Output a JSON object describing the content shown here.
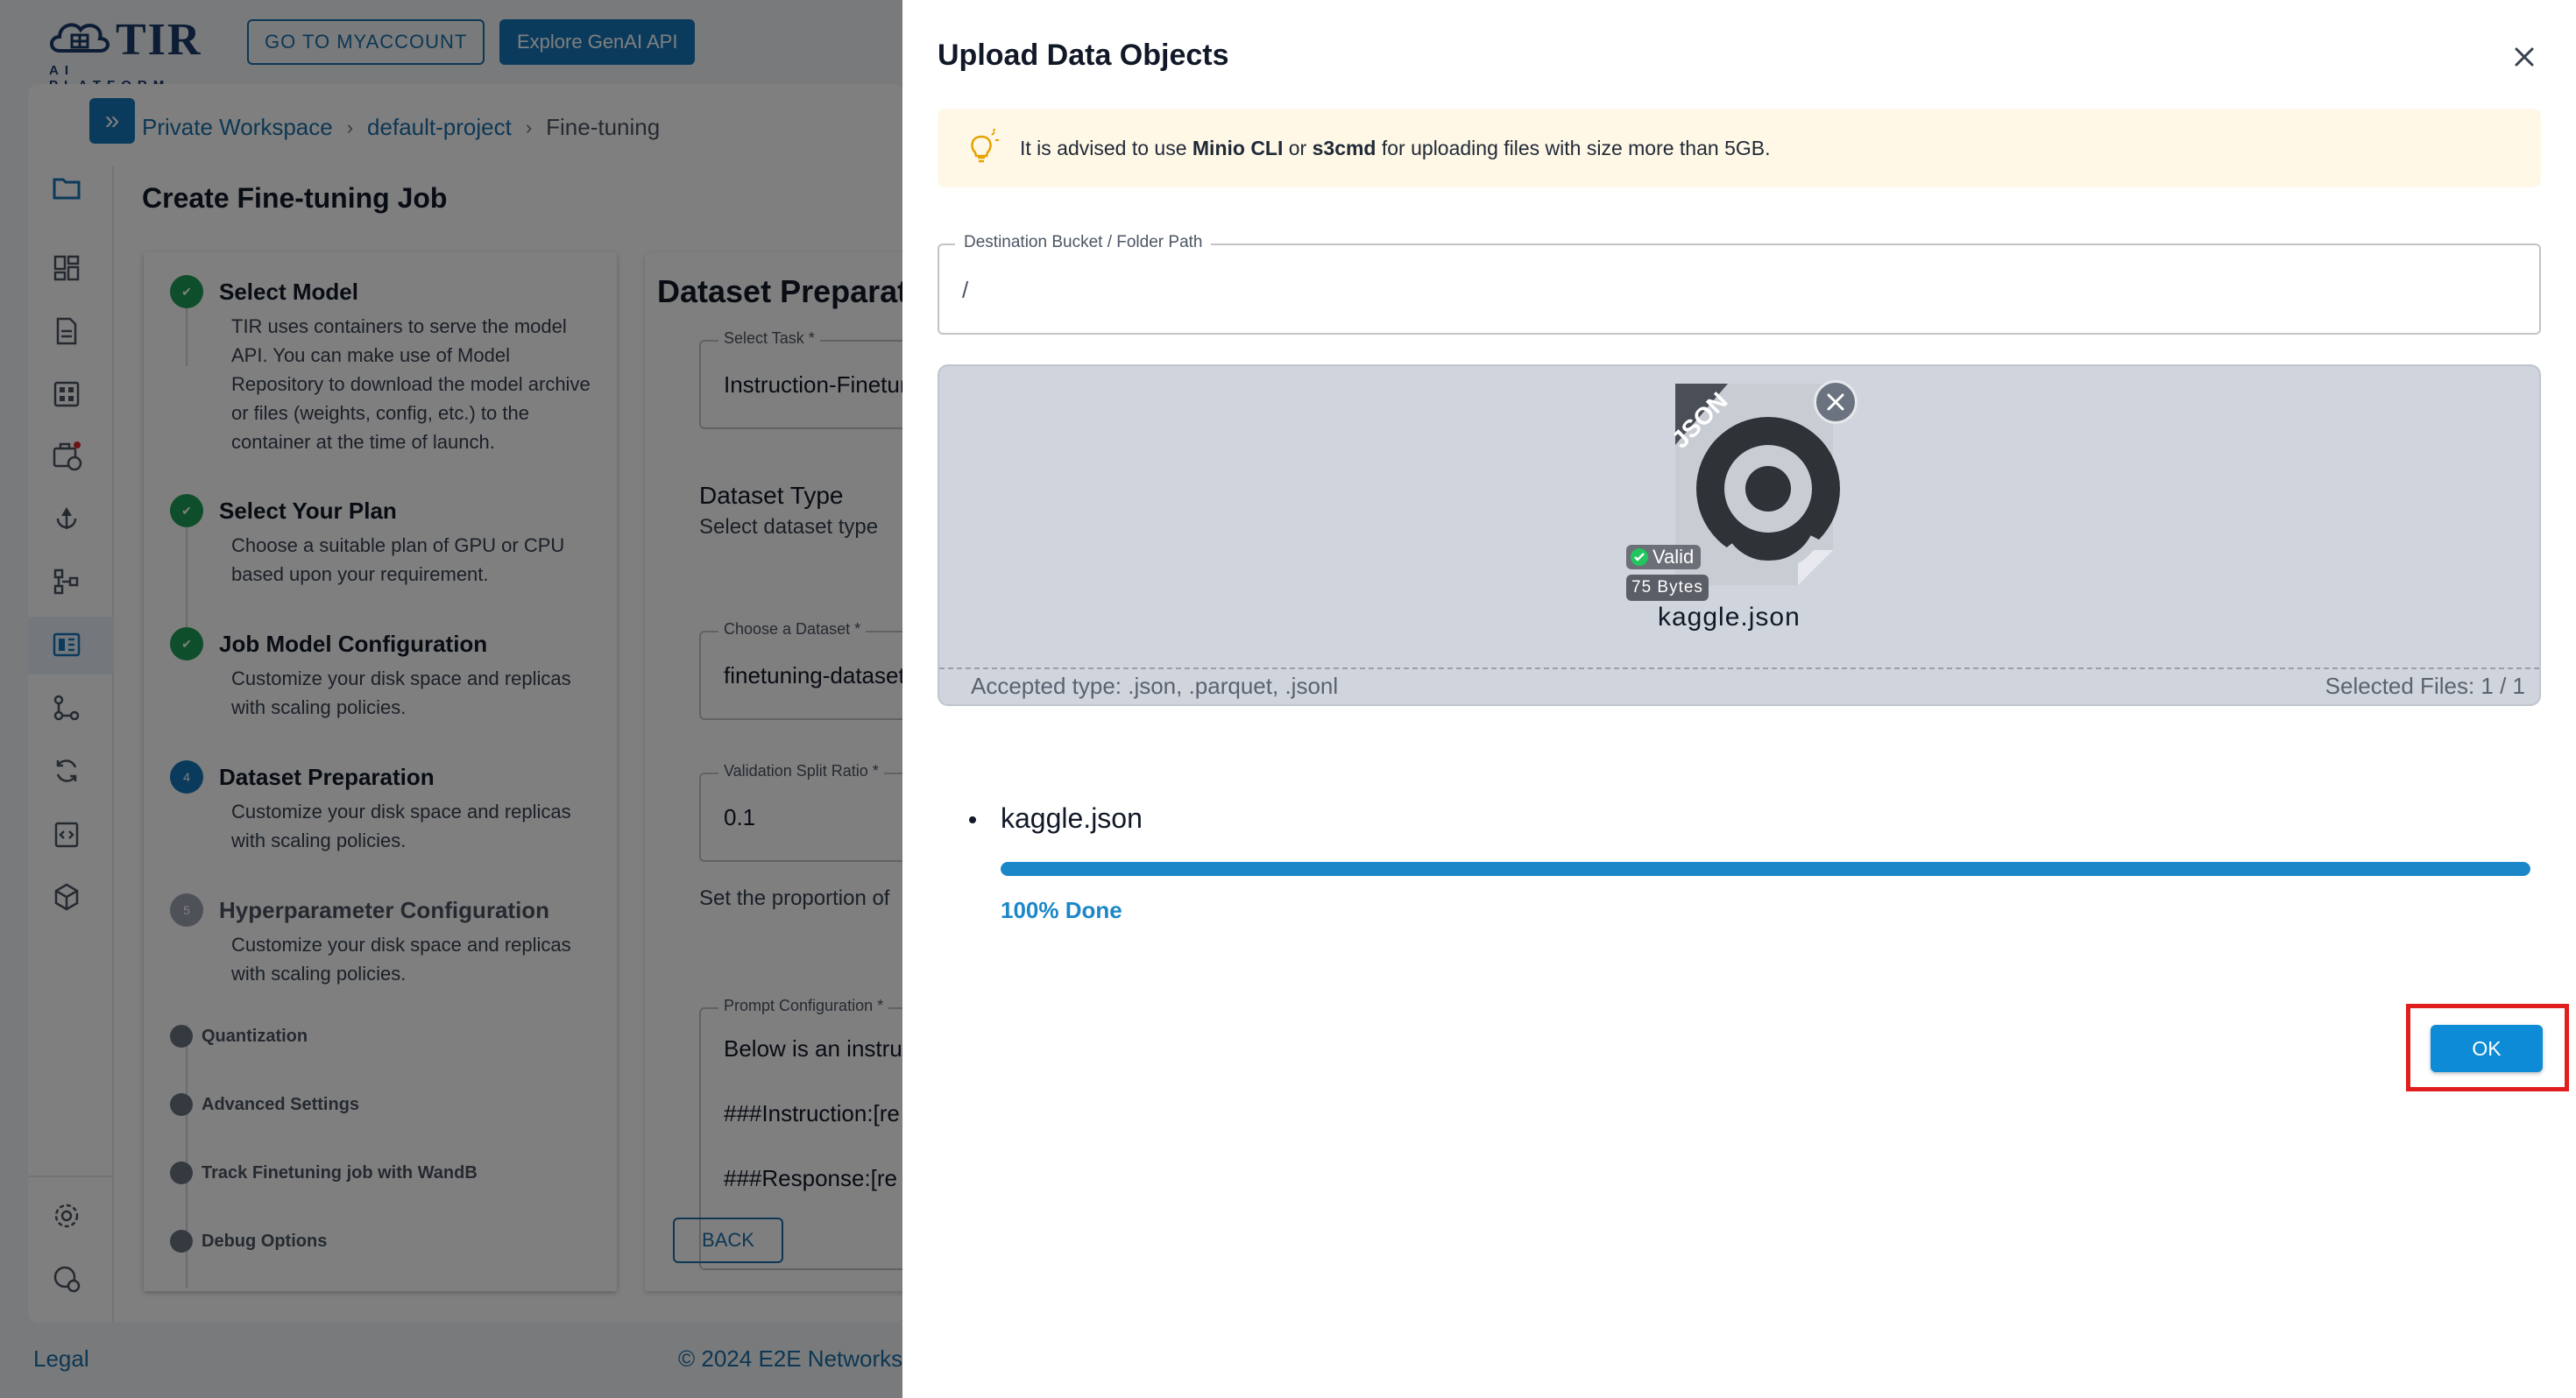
{
  "brand": {
    "name": "TIR",
    "sub": "AI PLATFORM"
  },
  "header": {
    "myaccount_label": "GO TO MYACCOUNT",
    "genai_label": "Explore GenAI API"
  },
  "breadcrumb": {
    "items": [
      "Private Workspace",
      "default-project",
      "Fine-tuning"
    ],
    "separator": "›"
  },
  "page": {
    "title": "Create Fine-tuning Job"
  },
  "stepper": {
    "steps": [
      {
        "title": "Select Model",
        "desc": "TIR uses containers to serve the model API. You can make use of Model Repository to download the model archive or files (weights, config, etc.) to the container at the time of launch.",
        "state": "done"
      },
      {
        "title": "Select Your Plan",
        "desc": "Choose a suitable plan of GPU or CPU based upon your requirement.",
        "state": "done"
      },
      {
        "title": "Job Model Configuration",
        "desc": "Customize your disk space and replicas with scaling policies.",
        "state": "done"
      },
      {
        "title": "Dataset Preparation",
        "number": "4",
        "desc": "Customize your disk space and replicas with scaling policies.",
        "state": "active"
      },
      {
        "title": "Hyperparameter Configuration",
        "number": "5",
        "desc": "Customize your disk space and replicas with scaling policies.",
        "state": "todo"
      }
    ],
    "substeps": [
      "Quantization",
      "Advanced Settings",
      "Track Finetuning job with WandB",
      "Debug Options"
    ]
  },
  "dataset": {
    "title": "Dataset Preparation",
    "task_label": "Select Task *",
    "task_value": "Instruction-Finetuning",
    "type_title": "Dataset Type",
    "type_sub": "Select dataset type",
    "dataset_label": "Choose a Dataset *",
    "dataset_value": "finetuning-dataset",
    "split_label": "Validation Split Ratio *",
    "split_value": "0.1",
    "split_help": "Set the proportion of",
    "prompt_label": "Prompt Configuration *",
    "prompt_line1": "Below is an instruction",
    "prompt_line2": "###Instruction:[re",
    "prompt_line3": "###Response:[re",
    "back_label": "BACK"
  },
  "footer": {
    "legal": "Legal",
    "copyright": "© 2024 E2E Networks"
  },
  "dialog": {
    "title": "Upload Data Objects",
    "alert": {
      "prefix": "It is advised to use ",
      "tool1": "Minio CLI",
      "mid": " or ",
      "tool2": "s3cmd",
      "suffix": " for uploading files with size more than 5GB."
    },
    "destination": {
      "label": "Destination Bucket / Folder Path",
      "value": "/"
    },
    "dropzone": {
      "accepted": "Accepted type: .json, .parquet, .jsonl",
      "selected": "Selected Files: 1 / 1"
    },
    "file": {
      "name": "kaggle.json",
      "badge_valid": "Valid",
      "badge_size": "75 Bytes",
      "type_tag": "JSON"
    },
    "upload": {
      "name": "kaggle.json",
      "progress": 1.0,
      "status": "100% Done"
    },
    "ok_label": "OK"
  },
  "colors": {
    "accent": "#1677b8",
    "success": "#1f9d55",
    "progress": "#1b87c9",
    "highlight": "#e01e1e"
  }
}
